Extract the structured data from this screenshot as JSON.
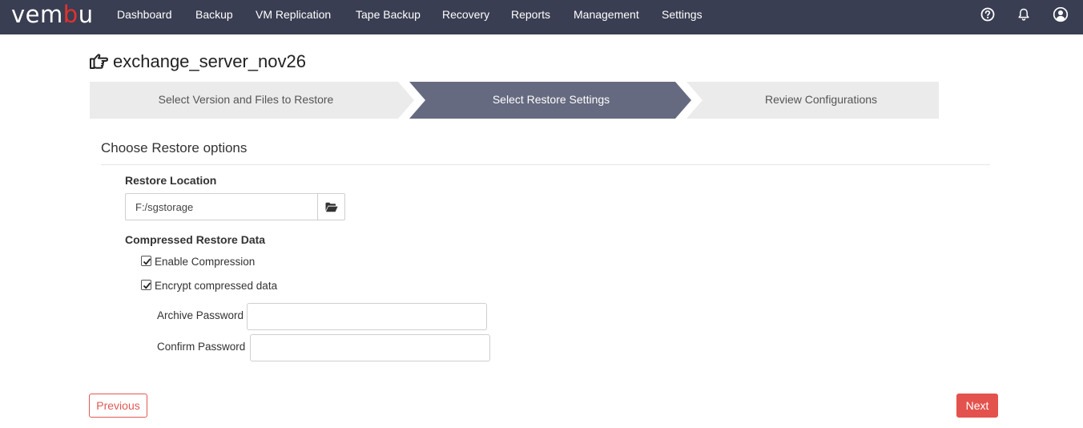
{
  "app": {
    "logo_text_start": "vem",
    "logo_text_accent": "b",
    "logo_text_end": "u",
    "brand_color": "#e3322e"
  },
  "nav": {
    "items": [
      {
        "label": "Dashboard"
      },
      {
        "label": "Backup"
      },
      {
        "label": "VM Replication"
      },
      {
        "label": "Tape Backup"
      },
      {
        "label": "Recovery"
      },
      {
        "label": "Reports"
      },
      {
        "label": "Management"
      },
      {
        "label": "Settings"
      }
    ],
    "icons": [
      "help-icon",
      "bell-icon",
      "user-icon"
    ]
  },
  "page": {
    "title": "exchange_server_nov26",
    "title_icon": "hand-pointing-icon"
  },
  "wizard": {
    "steps": [
      {
        "label": "Select Version and Files to Restore",
        "state": "completed"
      },
      {
        "label": "Select Restore Settings",
        "state": "active"
      },
      {
        "label": "Review Configurations",
        "state": "pending"
      }
    ],
    "active_color": "#666a80",
    "inactive_color": "#ebebeb"
  },
  "form": {
    "section_title": "Choose Restore options",
    "restore_location": {
      "label": "Restore Location",
      "value": "F:/sgstorage",
      "browse_icon": "folder-open-icon"
    },
    "compressed": {
      "label": "Compressed Restore Data",
      "enable_compression": {
        "label": "Enable Compression",
        "checked": true
      },
      "encrypt": {
        "label": "Encrypt compressed data",
        "checked": true
      }
    },
    "archive_password": {
      "label": "Archive Password",
      "value": ""
    },
    "confirm_password": {
      "label": "Confirm Password",
      "value": ""
    }
  },
  "footer": {
    "previous_label": "Previous",
    "next_label": "Next"
  }
}
